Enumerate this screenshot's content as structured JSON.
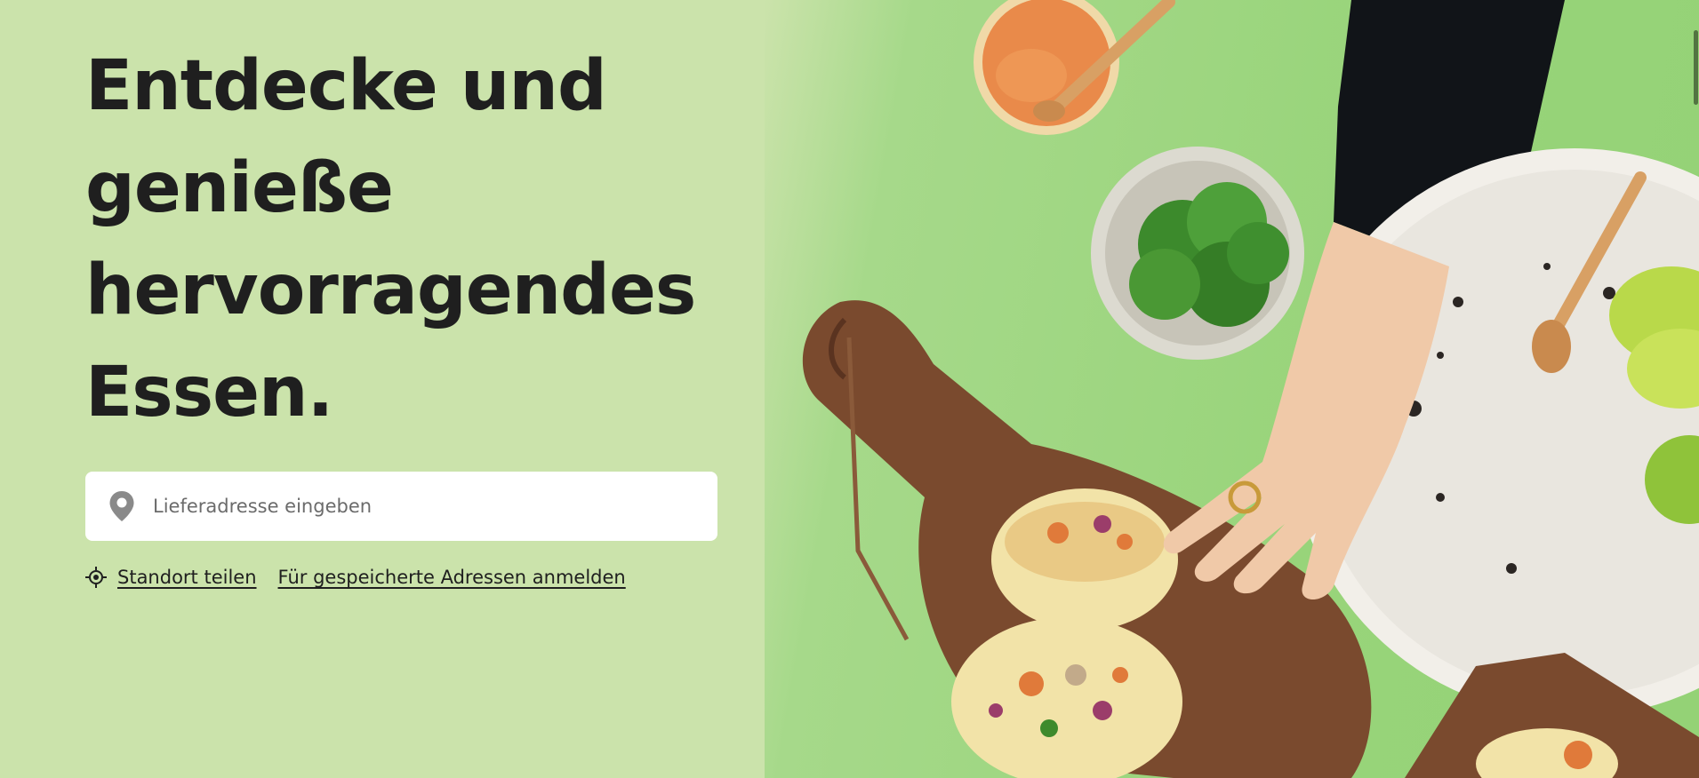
{
  "hero": {
    "headline_lines": [
      "Entdecke und",
      "genieße",
      "hervorragendes",
      "Essen."
    ]
  },
  "address": {
    "placeholder": "Lieferadresse eingeben",
    "value": ""
  },
  "links": {
    "share_location": "Standort teilen",
    "saved_addresses": "Für gespeicherte Adressen anmelden"
  },
  "icons": {
    "pin": "location-pin-icon",
    "locate": "crosshair-icon"
  },
  "colors": {
    "background": "#cbe3ab",
    "text": "#1f1f1f",
    "input_bg": "#ffffff",
    "food_bg": "#96d378"
  }
}
